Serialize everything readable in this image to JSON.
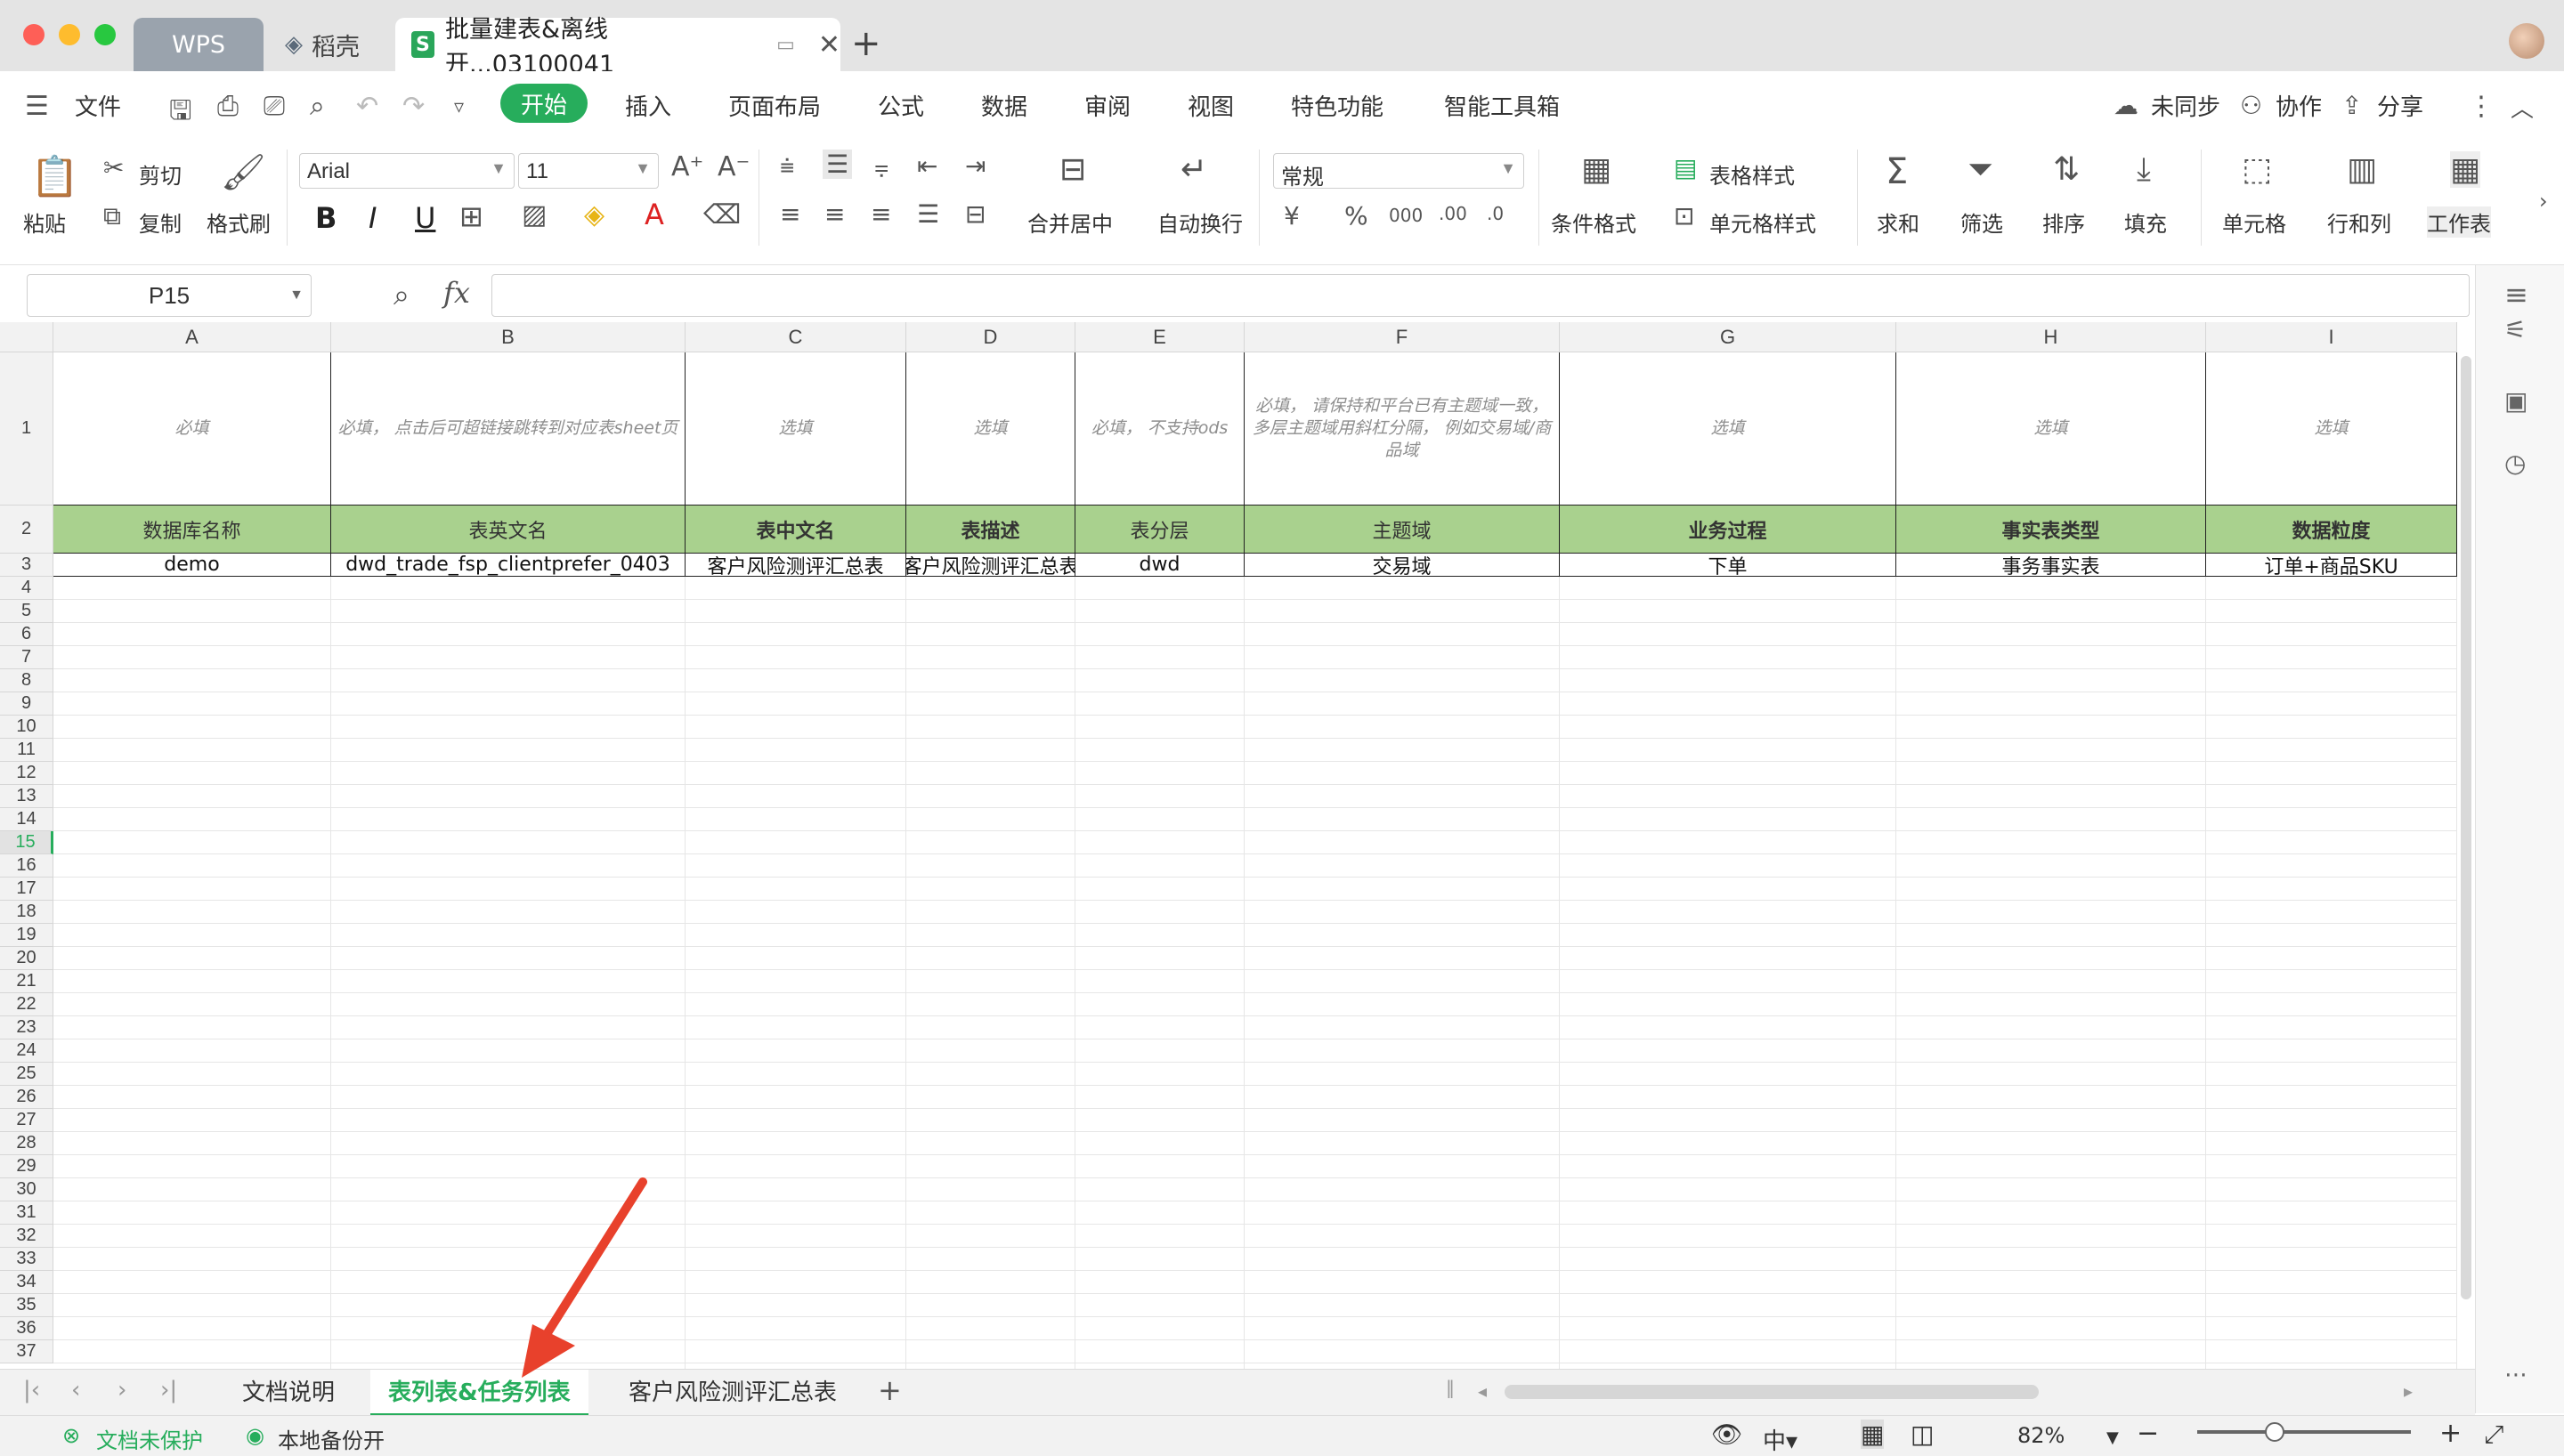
{
  "titlebar": {
    "tabs": [
      {
        "label": "WPS"
      },
      {
        "label": "稻壳"
      },
      {
        "label": "批量建表&离线开...03100041"
      }
    ]
  },
  "menu": {
    "file": "文件",
    "items": [
      "开始",
      "插入",
      "页面布局",
      "公式",
      "数据",
      "审阅",
      "视图",
      "特色功能",
      "智能工具箱"
    ],
    "right": [
      "未同步",
      "协作",
      "分享"
    ]
  },
  "ribbon": {
    "paste": "粘贴",
    "cut": "剪切",
    "copy": "复制",
    "format_painter": "格式刷",
    "font_name": "Arial",
    "font_size": "11",
    "merge_center": "合并居中",
    "wrap_text": "自动换行",
    "number_format": "常规",
    "conditional_format": "条件格式",
    "table_style": "表格样式",
    "cell_style": "单元格样式",
    "sum": "求和",
    "filter": "筛选",
    "sort": "排序",
    "fill": "填充",
    "cell": "单元格",
    "row_col": "行和列",
    "worksheet": "工作表"
  },
  "formula_bar": {
    "name_box": "P15",
    "fx": "fx",
    "value": ""
  },
  "sheet": {
    "columns": [
      {
        "letter": "A"
      },
      {
        "letter": "B"
      },
      {
        "letter": "C"
      },
      {
        "letter": "D"
      },
      {
        "letter": "E"
      },
      {
        "letter": "F"
      },
      {
        "letter": "G"
      },
      {
        "letter": "H"
      },
      {
        "letter": "I"
      }
    ],
    "rows": {
      "hints": [
        "必填",
        "必填， 点击后可超链接跳转到对应表sheet页",
        "选填",
        "选填",
        "必填， 不支持ods",
        "必填， 请保持和平台已有主题域一致， 多层主题域用斜杠分隔， 例如交易域/商品域",
        "选填",
        "选填",
        "选填"
      ],
      "headers": [
        "数据库名称",
        "表英文名",
        "表中文名",
        "表描述",
        "表分层",
        "主题域",
        "业务过程",
        "事实表类型",
        "数据粒度"
      ],
      "data": [
        "demo",
        "dwd_trade_fsp_clientprefer_0403",
        "客户风险测评汇总表",
        "客户风险测评汇总表",
        "dwd",
        "交易域",
        "下单",
        "事务事实表",
        "订单+商品SKU"
      ]
    },
    "row_numbers": [
      "1",
      "2",
      "3",
      "4",
      "5",
      "6",
      "7",
      "8",
      "9",
      "10",
      "11",
      "12",
      "13",
      "14",
      "15",
      "16",
      "17",
      "18",
      "19",
      "20",
      "21",
      "22",
      "23",
      "24",
      "25",
      "26",
      "27",
      "28",
      "29",
      "30",
      "31",
      "32",
      "33",
      "34",
      "35",
      "36",
      "37"
    ],
    "selected_row": "15"
  },
  "sheet_tabs": [
    "文档说明",
    "表列表&任务列表",
    "客户风险测评汇总表"
  ],
  "active_sheet": "表列表&任务列表",
  "status": {
    "protect": "文档未保护",
    "backup": "本地备份开",
    "zoom": "82%"
  },
  "colors": {
    "accent": "#27ad5c",
    "header_fill": "#a9d18e",
    "arrow": "#e8412c"
  }
}
